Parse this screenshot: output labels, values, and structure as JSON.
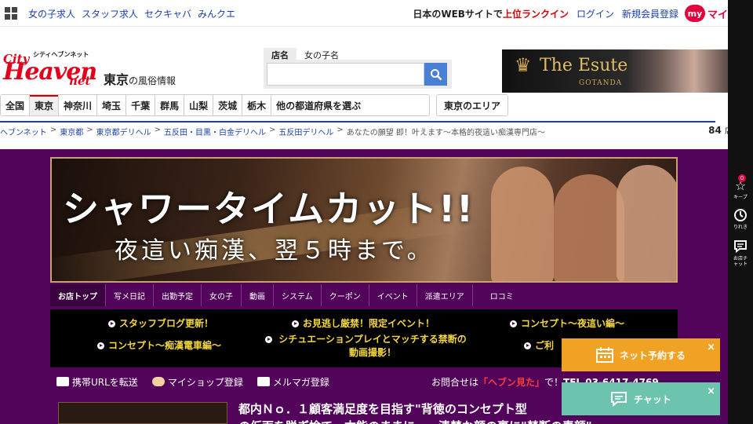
{
  "topbar": {
    "links": [
      "女の子求人",
      "スタッフ求人",
      "セクキャバ",
      "みんクエ"
    ],
    "lead_text": "日本のWEBサイトで",
    "lead_highlight": "上位ランクイン",
    "login": "ログイン",
    "register": "新規会員登録",
    "my_badge": "my",
    "my_text": "マイ"
  },
  "header": {
    "logo_kana": "シティヘブンネット",
    "logo_city": "City",
    "logo_heaven": "Heaven",
    "logo_net": "net",
    "area": "東京",
    "area_suffix": "の風俗情報"
  },
  "search": {
    "tabs": [
      "店名",
      "女の子名"
    ],
    "placeholder": ""
  },
  "ad_banner": {
    "name": "The Esute",
    "sub": "GOTANDA"
  },
  "prefnav": {
    "items": [
      "全国",
      "東京",
      "神奈川",
      "埼玉",
      "千葉",
      "群馬",
      "山梨",
      "茨城",
      "栃木",
      "他の都道府県を選ぶ"
    ],
    "active": "東京",
    "area_button": "東京のエリア"
  },
  "breadcrumb": {
    "items": [
      "ヘブンネット",
      "東京都",
      "東京都デリヘル",
      "五反田・目黒・白金デリヘル",
      "五反田デリヘル"
    ],
    "current": "あなたの願望 即！叶えます〜本格的夜這い痴漢専門店〜",
    "shop_count": "84",
    "shop_count_unit": "店舗"
  },
  "hero": {
    "line1": "シャワータイムカット!!",
    "line2": "夜這い痴漢、翌５時まで。"
  },
  "shopnav": {
    "items": [
      "お店トップ",
      "写メ日記",
      "出勤予定",
      "女の子",
      "動画",
      "システム",
      "クーポン",
      "イベント",
      "派遣エリア",
      "ロコミ"
    ]
  },
  "notices": {
    "n1": "スタッフブログ更新！",
    "n2": "お見逃し厳禁！限定イベント！",
    "n3": "コンセプト〜夜這い編〜",
    "n4": "コンセプト〜痴漢電車編〜",
    "n5": "シチュエーションプレイとマッチする禁断の動画撮影！",
    "n6": "ご利"
  },
  "actions": {
    "share": "携帯URLを転送",
    "myshop": "マイショップ登録",
    "mailmag": "メルマガ登録"
  },
  "contact": {
    "prefix": "お問合せは",
    "highlight": "「ヘブン見た」",
    "suffix": "で！",
    "tel": "TEL 03-6417-4769"
  },
  "headline": {
    "line1": "都内Ｎｏ．１顧客満足度を目指す\"背徳のコンセプト型",
    "line2": "の仮面を脱ぎ捨て…本能のままに……清楚な顔の裏に\"禁断の素顔\""
  },
  "floating": {
    "reserve": "ネット予約する",
    "chat": "チャット",
    "close": "×"
  },
  "sidebar": {
    "keep": "キープ",
    "keep_count": "0",
    "history": "りれき",
    "chat": "お店チャット"
  },
  "colors": {
    "brand_red": "#e4001b",
    "shop_purple": "#52035a",
    "notice_yellow": "#f4d63f",
    "reserve_orange": "#f0a224",
    "chat_green": "#6cc4ae",
    "link_blue": "#1a3fa5"
  }
}
